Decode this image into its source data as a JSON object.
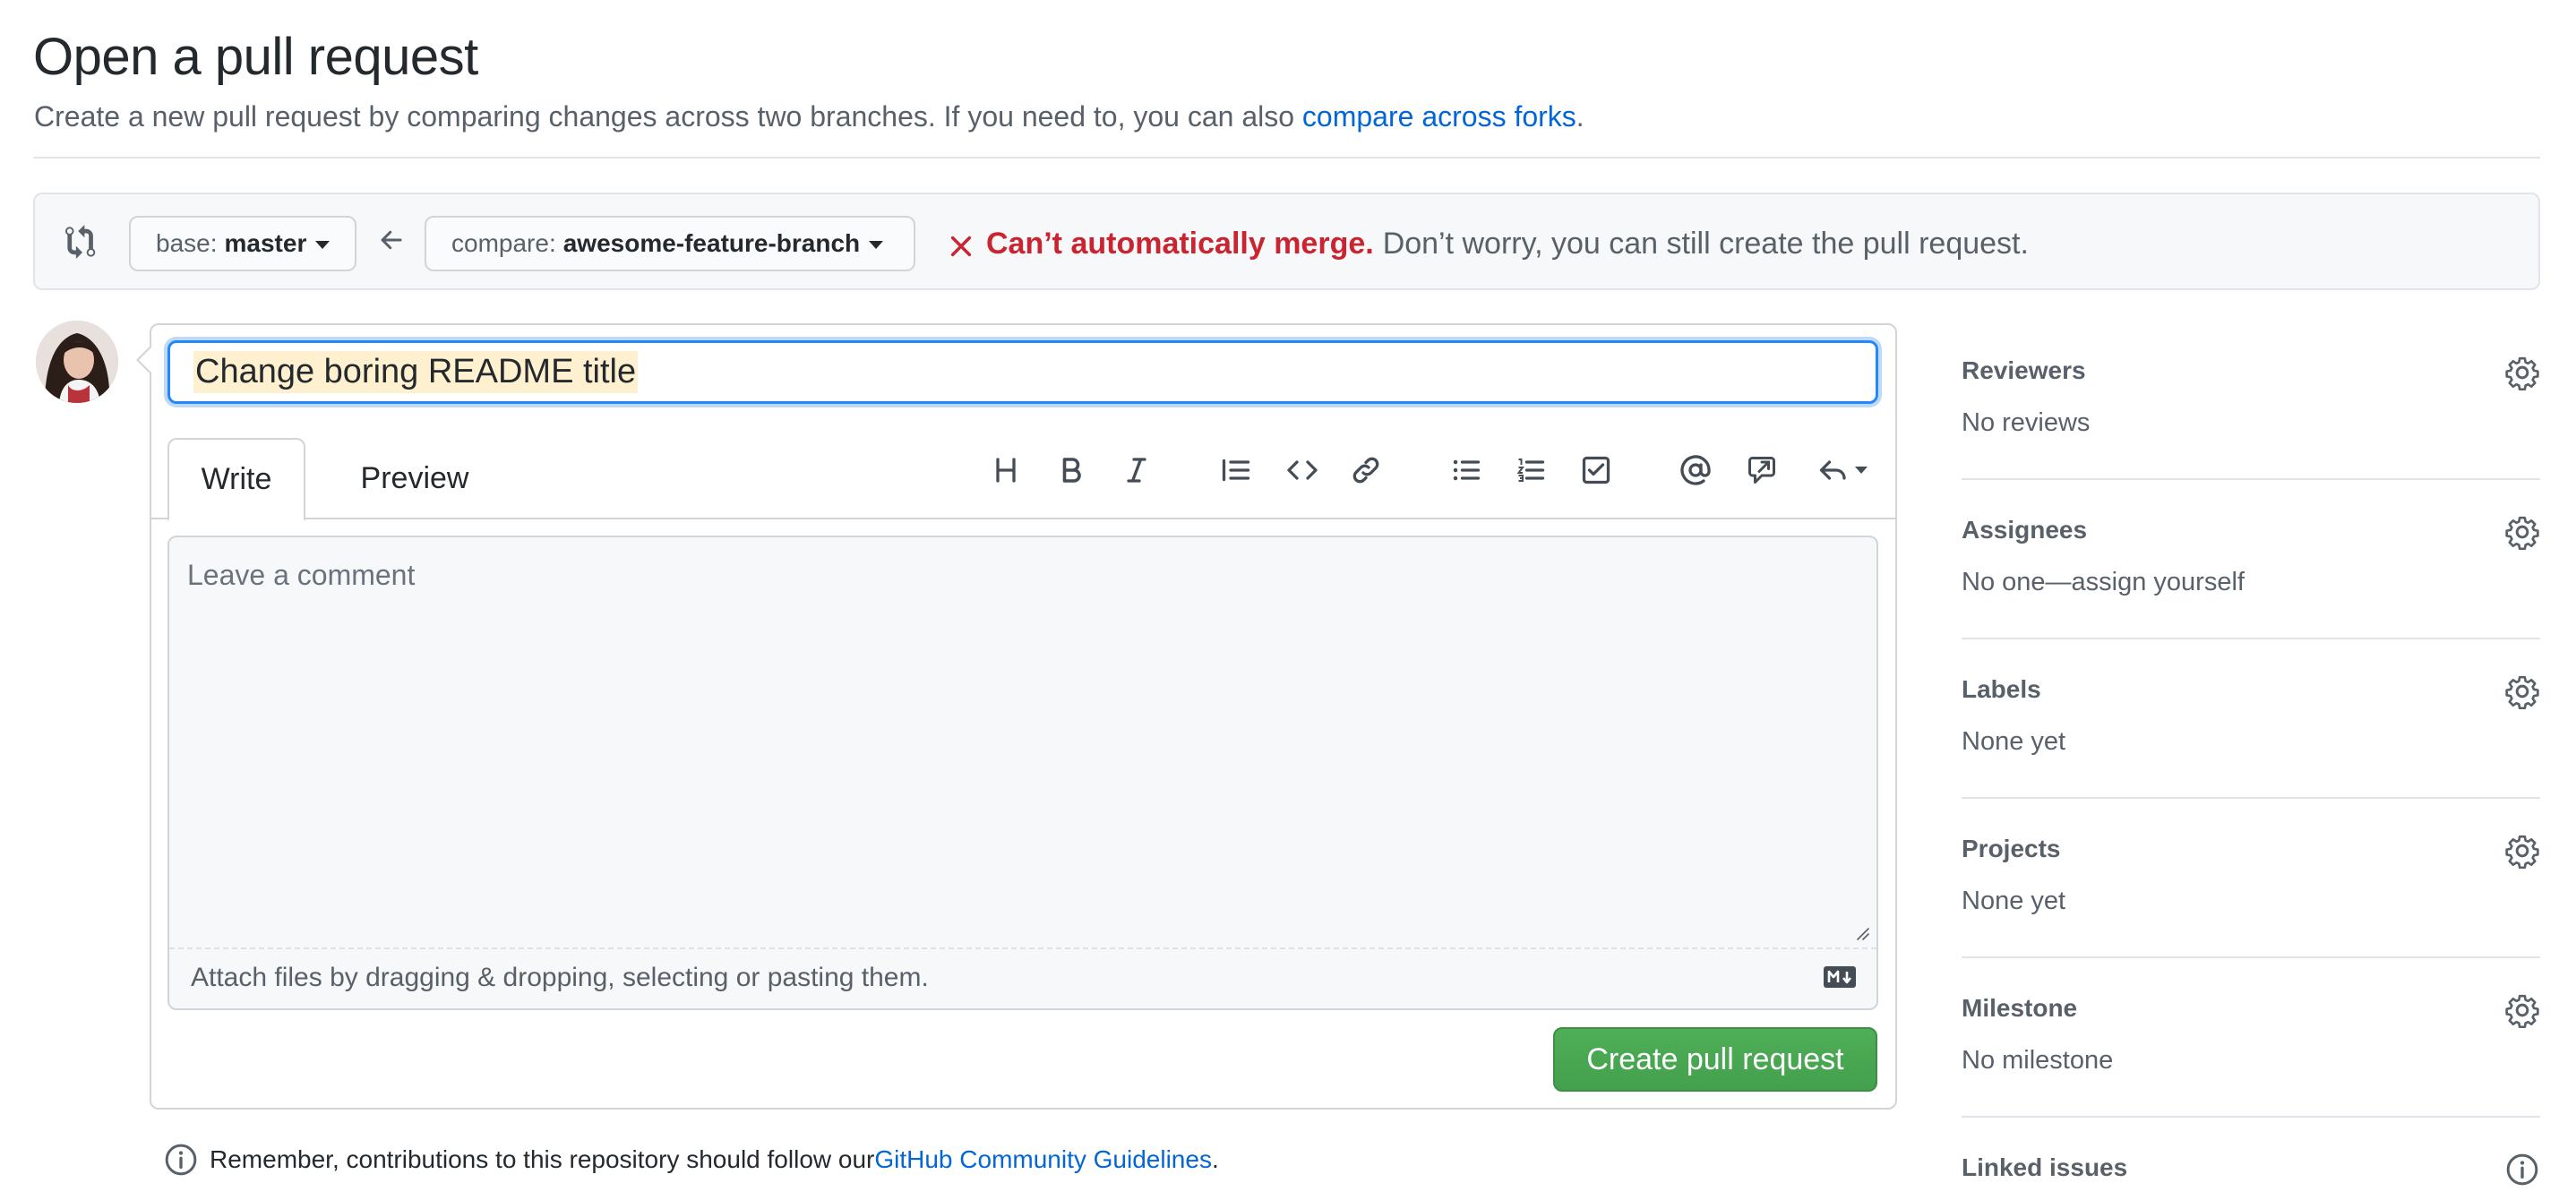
{
  "header": {
    "title": "Open a pull request",
    "subtitle_prefix": "Create a new pull request by comparing changes across two branches. If you need to, you can also ",
    "subtitle_link": "compare across forks",
    "subtitle_suffix": "."
  },
  "compare_bar": {
    "base_prefix": "base:",
    "base_branch": "master",
    "compare_prefix": "compare:",
    "compare_branch": "awesome-feature-branch",
    "merge_error": "Can’t automatically merge.",
    "merge_message": "Don’t worry, you can still create the pull request."
  },
  "composer": {
    "title_value": "Change boring README title",
    "tab_write": "Write",
    "tab_preview": "Preview",
    "comment_placeholder": "Leave a comment",
    "attach_text": "Attach files by dragging & dropping, selecting or pasting them.",
    "submit_label": "Create pull request",
    "toolbar_icons": [
      "heading-icon",
      "bold-icon",
      "italic-icon",
      "quote-icon",
      "code-icon",
      "link-icon",
      "bulleted-list-icon",
      "numbered-list-icon",
      "task-list-icon",
      "mention-icon",
      "cross-reference-icon",
      "reply-icon"
    ]
  },
  "footer": {
    "note_prefix": "Remember, contributions to this repository should follow our ",
    "note_link": "GitHub Community Guidelines",
    "note_suffix": "."
  },
  "sidebar": {
    "items": [
      {
        "label": "Reviewers",
        "value": "No reviews"
      },
      {
        "label": "Assignees",
        "value": "No one—assign yourself"
      },
      {
        "label": "Labels",
        "value": "None yet"
      },
      {
        "label": "Projects",
        "value": "None yet"
      },
      {
        "label": "Milestone",
        "value": "No milestone"
      },
      {
        "label": "Linked issues",
        "value": ""
      }
    ]
  },
  "colors": {
    "link": "#0366d6",
    "error": "#cb2431",
    "primary_button": "#2ea44f",
    "focus": "#2188ff",
    "title_highlight": "#fff1cf"
  }
}
